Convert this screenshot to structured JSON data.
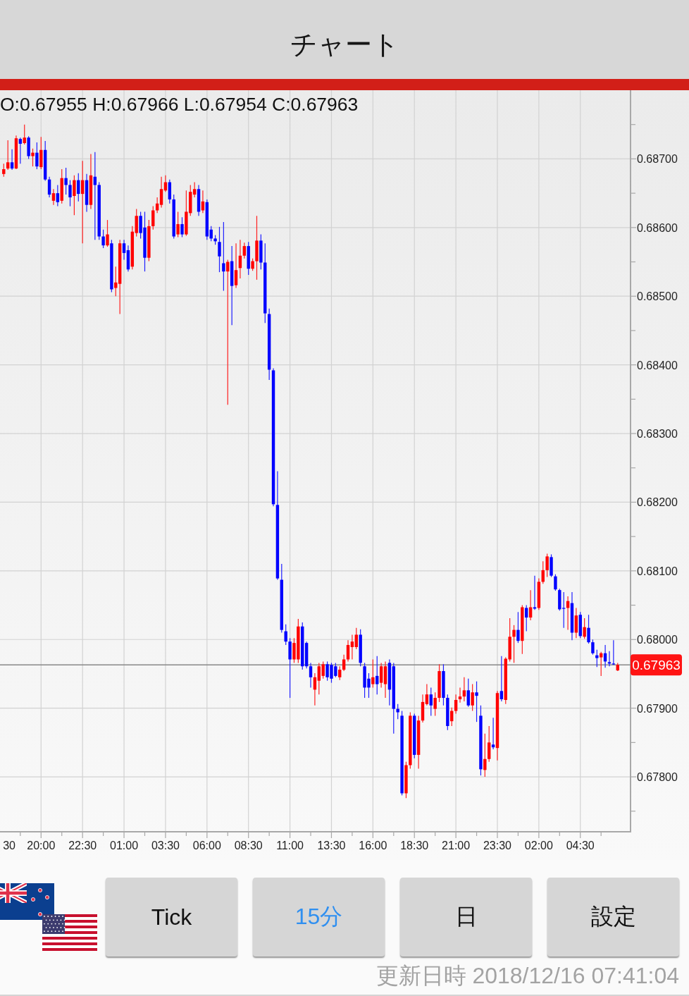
{
  "header": {
    "title": "チャート"
  },
  "chart": {
    "ohlc_readout": "O:0.67955 H:0.67966 L:0.67954 C:0.67963",
    "cut_time_label": "30",
    "chart_data": {
      "type": "candlestick",
      "grid": true,
      "ylim": [
        0.6772,
        0.688
      ],
      "yticks": [
        {
          "value": 0.687,
          "label": "0.68700"
        },
        {
          "value": 0.686,
          "label": "0.68600"
        },
        {
          "value": 0.685,
          "label": "0.68500"
        },
        {
          "value": 0.684,
          "label": "0.68400"
        },
        {
          "value": 0.683,
          "label": "0.68300"
        },
        {
          "value": 0.682,
          "label": "0.68200"
        },
        {
          "value": 0.681,
          "label": "0.68100"
        },
        {
          "value": 0.68,
          "label": "0.68000"
        },
        {
          "value": 0.679,
          "label": "0.67900"
        },
        {
          "value": 0.678,
          "label": "0.67800"
        }
      ],
      "ref_lines": [
        {
          "axis": "y",
          "value": 0.67963,
          "label": "0.67963"
        }
      ],
      "categories": [
        null,
        null,
        null,
        null,
        null,
        null,
        null,
        null,
        null,
        "20:00",
        null,
        null,
        null,
        null,
        null,
        null,
        null,
        null,
        null,
        "22:30",
        null,
        null,
        null,
        null,
        null,
        null,
        null,
        null,
        null,
        "01:00",
        null,
        null,
        null,
        null,
        null,
        null,
        null,
        null,
        null,
        "03:30",
        null,
        null,
        null,
        null,
        null,
        null,
        null,
        null,
        null,
        "06:00",
        null,
        null,
        null,
        null,
        null,
        null,
        null,
        null,
        null,
        "08:30",
        null,
        null,
        null,
        null,
        null,
        null,
        null,
        null,
        null,
        "11:00",
        null,
        null,
        null,
        null,
        null,
        null,
        null,
        null,
        null,
        "13:30",
        null,
        null,
        null,
        null,
        null,
        null,
        null,
        null,
        null,
        "16:00",
        null,
        null,
        null,
        null,
        null,
        null,
        null,
        null,
        null,
        "18:30",
        null,
        null,
        null,
        null,
        null,
        null,
        null,
        null,
        null,
        "21:00",
        null,
        null,
        null,
        null,
        null,
        null,
        null,
        null,
        null,
        "23:30",
        null,
        null,
        null,
        null,
        null,
        null,
        null,
        null,
        null,
        "02:00",
        null,
        null,
        null,
        null,
        null,
        null,
        null,
        null,
        null,
        "04:30",
        null,
        null,
        null,
        null,
        null,
        null,
        null,
        null,
        null
      ],
      "ohlc": [
        [
          0.68678,
          0.68693,
          0.68674,
          0.68685
        ],
        [
          0.68686,
          0.68727,
          0.68684,
          0.68695
        ],
        [
          0.68695,
          0.68714,
          0.68684,
          0.68686
        ],
        [
          0.68686,
          0.68734,
          0.68685,
          0.6873
        ],
        [
          0.68729,
          0.68731,
          0.68693,
          0.68722
        ],
        [
          0.68723,
          0.6875,
          0.68721,
          0.68731
        ],
        [
          0.68731,
          0.68733,
          0.687,
          0.68704
        ],
        [
          0.68704,
          0.68715,
          0.68689,
          0.68709
        ],
        [
          0.68709,
          0.68724,
          0.68685,
          0.68689
        ],
        [
          0.68688,
          0.68732,
          0.68685,
          0.68713
        ],
        [
          0.68713,
          0.68726,
          0.68668,
          0.6867
        ],
        [
          0.6867,
          0.68674,
          0.68644,
          0.68648
        ],
        [
          0.68639,
          0.68656,
          0.68633,
          0.6865
        ],
        [
          0.6865,
          0.68662,
          0.68631,
          0.68637
        ],
        [
          0.68639,
          0.68685,
          0.68635,
          0.68672
        ],
        [
          0.68672,
          0.68687,
          0.68648,
          0.68662
        ],
        [
          0.68662,
          0.68669,
          0.68631,
          0.68644
        ],
        [
          0.68646,
          0.68676,
          0.68618,
          0.68669
        ],
        [
          0.68669,
          0.68679,
          0.68638,
          0.68649
        ],
        [
          0.68649,
          0.68697,
          0.68577,
          0.68669
        ],
        [
          0.68669,
          0.68678,
          0.68623,
          0.68633
        ],
        [
          0.68633,
          0.68707,
          0.68627,
          0.68676
        ],
        [
          0.68674,
          0.6871,
          0.68582,
          0.68662
        ],
        [
          0.68662,
          0.68666,
          0.68582,
          0.68587
        ],
        [
          0.68587,
          0.68597,
          0.6857,
          0.68574
        ],
        [
          0.68574,
          0.68611,
          0.68572,
          0.6859
        ],
        [
          0.68577,
          0.68582,
          0.68506,
          0.6851
        ],
        [
          0.68512,
          0.68543,
          0.685,
          0.6852
        ],
        [
          0.68518,
          0.68582,
          0.68474,
          0.68577
        ],
        [
          0.68577,
          0.68582,
          0.68553,
          0.68563
        ],
        [
          0.68567,
          0.68574,
          0.68536,
          0.68539
        ],
        [
          0.68543,
          0.68602,
          0.68539,
          0.68594
        ],
        [
          0.68592,
          0.68627,
          0.68587,
          0.68617
        ],
        [
          0.68617,
          0.68623,
          0.68584,
          0.68592
        ],
        [
          0.686,
          0.68623,
          0.68536,
          0.68556
        ],
        [
          0.68556,
          0.68611,
          0.68551,
          0.68602
        ],
        [
          0.68602,
          0.68631,
          0.68597,
          0.68625
        ],
        [
          0.68625,
          0.68644,
          0.68621,
          0.68635
        ],
        [
          0.68633,
          0.68674,
          0.68629,
          0.68656
        ],
        [
          0.68654,
          0.68676,
          0.68652,
          0.68666
        ],
        [
          0.68666,
          0.6867,
          0.68635,
          0.68641
        ],
        [
          0.68641,
          0.68648,
          0.68584,
          0.68587
        ],
        [
          0.6859,
          0.68623,
          0.68586,
          0.68605
        ],
        [
          0.68605,
          0.68615,
          0.68586,
          0.6859
        ],
        [
          0.6859,
          0.68654,
          0.68588,
          0.68623
        ],
        [
          0.68621,
          0.68662,
          0.68617,
          0.68652
        ],
        [
          0.68648,
          0.68666,
          0.68644,
          0.68656
        ],
        [
          0.68656,
          0.68662,
          0.68617,
          0.68623
        ],
        [
          0.68625,
          0.68654,
          0.68621,
          0.68638
        ],
        [
          0.68637,
          0.68641,
          0.68582,
          0.68587
        ],
        [
          0.68597,
          0.68602,
          0.6858,
          0.68584
        ],
        [
          0.68584,
          0.68589,
          0.68575,
          0.6858
        ],
        [
          0.68579,
          0.68601,
          0.68535,
          0.68558
        ],
        [
          0.68548,
          0.68608,
          0.68508,
          0.68536
        ],
        [
          0.68536,
          0.68553,
          0.68342,
          0.6855
        ],
        [
          0.68551,
          0.68573,
          0.68458,
          0.68515
        ],
        [
          0.68516,
          0.68577,
          0.68512,
          0.68538
        ],
        [
          0.68541,
          0.68582,
          0.68526,
          0.68559
        ],
        [
          0.68559,
          0.68578,
          0.68555,
          0.68573
        ],
        [
          0.68573,
          0.68579,
          0.68531,
          0.6854
        ],
        [
          0.6854,
          0.68555,
          0.68537,
          0.68551
        ],
        [
          0.68551,
          0.68617,
          0.68524,
          0.68581
        ],
        [
          0.68581,
          0.6859,
          0.68539,
          0.68549
        ],
        [
          0.68549,
          0.68577,
          0.68461,
          0.68475
        ],
        [
          0.68474,
          0.68482,
          0.68378,
          0.68393
        ],
        [
          0.68392,
          0.68395,
          0.68194,
          0.68197
        ],
        [
          0.68196,
          0.68245,
          0.68087,
          0.68089
        ],
        [
          0.68087,
          0.6811,
          0.6801,
          0.68014
        ],
        [
          0.68012,
          0.68022,
          0.67992,
          0.67997
        ],
        [
          0.67997,
          0.68002,
          0.67915,
          0.67971
        ],
        [
          0.67971,
          0.68002,
          0.67966,
          0.67995
        ],
        [
          0.67971,
          0.6803,
          0.67966,
          0.68019
        ],
        [
          0.68019,
          0.68025,
          0.67956,
          0.67961
        ],
        [
          0.67995,
          0.67997,
          0.67958,
          0.67961
        ],
        [
          0.67961,
          0.67966,
          0.6793,
          0.67945
        ],
        [
          0.67927,
          0.67951,
          0.67904,
          0.67945
        ],
        [
          0.6794,
          0.67966,
          0.6792,
          0.67961
        ],
        [
          0.67947,
          0.67968,
          0.67943,
          0.67964
        ],
        [
          0.67964,
          0.67968,
          0.6794,
          0.67945
        ],
        [
          0.67963,
          0.67966,
          0.67937,
          0.67943
        ],
        [
          0.67961,
          0.67966,
          0.67945,
          0.67947
        ],
        [
          0.67945,
          0.67961,
          0.67941,
          0.67956
        ],
        [
          0.67956,
          0.67978,
          0.67954,
          0.67971
        ],
        [
          0.67971,
          0.67999,
          0.67968,
          0.67992
        ],
        [
          0.67989,
          0.68007,
          0.67971,
          0.67997
        ],
        [
          0.67989,
          0.68017,
          0.67986,
          0.68007
        ],
        [
          0.68007,
          0.68015,
          0.67961,
          0.67966
        ],
        [
          0.67961,
          0.67966,
          0.67915,
          0.6793
        ],
        [
          0.67943,
          0.67951,
          0.67915,
          0.6793
        ],
        [
          0.67935,
          0.67971,
          0.6793,
          0.67945
        ],
        [
          0.67947,
          0.67976,
          0.6792,
          0.67935
        ],
        [
          0.67937,
          0.67966,
          0.6793,
          0.67961
        ],
        [
          0.67935,
          0.67968,
          0.67915,
          0.67961
        ],
        [
          0.67966,
          0.67971,
          0.67904,
          0.67927
        ],
        [
          0.67961,
          0.67966,
          0.67863,
          0.67899
        ],
        [
          0.67899,
          0.67906,
          0.67884,
          0.67894
        ],
        [
          0.67889,
          0.67896,
          0.67773,
          0.67776
        ],
        [
          0.67776,
          0.67822,
          0.67769,
          0.67817
        ],
        [
          0.67817,
          0.67894,
          0.67812,
          0.67889
        ],
        [
          0.67889,
          0.67892,
          0.67827,
          0.67832
        ],
        [
          0.67832,
          0.67889,
          0.67812,
          0.67882
        ],
        [
          0.67882,
          0.6792,
          0.67879,
          0.67909
        ],
        [
          0.67906,
          0.67935,
          0.67904,
          0.6792
        ],
        [
          0.6792,
          0.6793,
          0.67889,
          0.67904
        ],
        [
          0.67899,
          0.67923,
          0.67889,
          0.67915
        ],
        [
          0.67915,
          0.67964,
          0.67909,
          0.67954
        ],
        [
          0.67954,
          0.67964,
          0.67904,
          0.67915
        ],
        [
          0.67915,
          0.6792,
          0.67868,
          0.67874
        ],
        [
          0.67881,
          0.67901,
          0.67874,
          0.67896
        ],
        [
          0.67896,
          0.6792,
          0.67892,
          0.67912
        ],
        [
          0.67913,
          0.6793,
          0.67908,
          0.67917
        ],
        [
          0.67917,
          0.67945,
          0.6791,
          0.67926
        ],
        [
          0.67926,
          0.67943,
          0.67902,
          0.67904
        ],
        [
          0.67904,
          0.67935,
          0.67896,
          0.67923
        ],
        [
          0.67923,
          0.67939,
          0.6788,
          0.67918
        ],
        [
          0.67889,
          0.67904,
          0.67802,
          0.67811
        ],
        [
          0.6781,
          0.67863,
          0.678,
          0.67826
        ],
        [
          0.67826,
          0.67874,
          0.67822,
          0.6785
        ],
        [
          0.67847,
          0.67886,
          0.6784,
          0.67843
        ],
        [
          0.67842,
          0.67925,
          0.67824,
          0.67922
        ],
        [
          0.67925,
          0.67976,
          0.6791,
          0.67913
        ],
        [
          0.67912,
          0.67974,
          0.67906,
          0.67972
        ],
        [
          0.67971,
          0.68031,
          0.67968,
          0.68004
        ],
        [
          0.68004,
          0.68021,
          0.67966,
          0.68014
        ],
        [
          0.68014,
          0.6804,
          0.67995,
          0.67998
        ],
        [
          0.67998,
          0.6805,
          0.67979,
          0.68047
        ],
        [
          0.68046,
          0.6805,
          0.68012,
          0.68032
        ],
        [
          0.68032,
          0.68072,
          0.68028,
          0.68047
        ],
        [
          0.68047,
          0.68093,
          0.68043,
          0.68045
        ],
        [
          0.68046,
          0.68089,
          0.68043,
          0.68084
        ],
        [
          0.68084,
          0.68114,
          0.68081,
          0.68101
        ],
        [
          0.68101,
          0.68125,
          0.68091,
          0.68121
        ],
        [
          0.6812,
          0.68124,
          0.68091,
          0.68093
        ],
        [
          0.68092,
          0.68095,
          0.68071,
          0.68073
        ],
        [
          0.68072,
          0.68074,
          0.68042,
          0.68044
        ],
        [
          0.68046,
          0.68069,
          0.68017,
          0.68045
        ],
        [
          0.68046,
          0.68063,
          0.68014,
          0.68056
        ],
        [
          0.68053,
          0.68069,
          0.67999,
          0.6801
        ],
        [
          0.6801,
          0.68046,
          0.68002,
          0.68035
        ],
        [
          0.68036,
          0.6804,
          0.68002,
          0.68005
        ],
        [
          0.68004,
          0.68031,
          0.68001,
          0.68018
        ],
        [
          0.68017,
          0.68036,
          0.67994,
          0.67996
        ],
        [
          0.67996,
          0.68,
          0.67978,
          0.6798
        ],
        [
          0.67977,
          0.67985,
          0.6796,
          0.67973
        ],
        [
          0.67974,
          0.67982,
          0.67947,
          0.6798
        ],
        [
          0.6798,
          0.67992,
          0.67959,
          0.67968
        ],
        [
          0.67967,
          0.67983,
          0.67961,
          0.67965
        ],
        [
          0.67965,
          0.67999,
          0.67963,
          0.67964
        ],
        [
          0.67955,
          0.67966,
          0.67954,
          0.67963
        ]
      ]
    }
  },
  "timeframe_buttons": [
    {
      "label": "Tick",
      "selected": false
    },
    {
      "label": "15分",
      "selected": true
    },
    {
      "label": "日",
      "selected": false
    }
  ],
  "settings_button": {
    "label": "設定"
  },
  "footer": {
    "updated": "更新日時 2018/12/16 07:41:04"
  }
}
